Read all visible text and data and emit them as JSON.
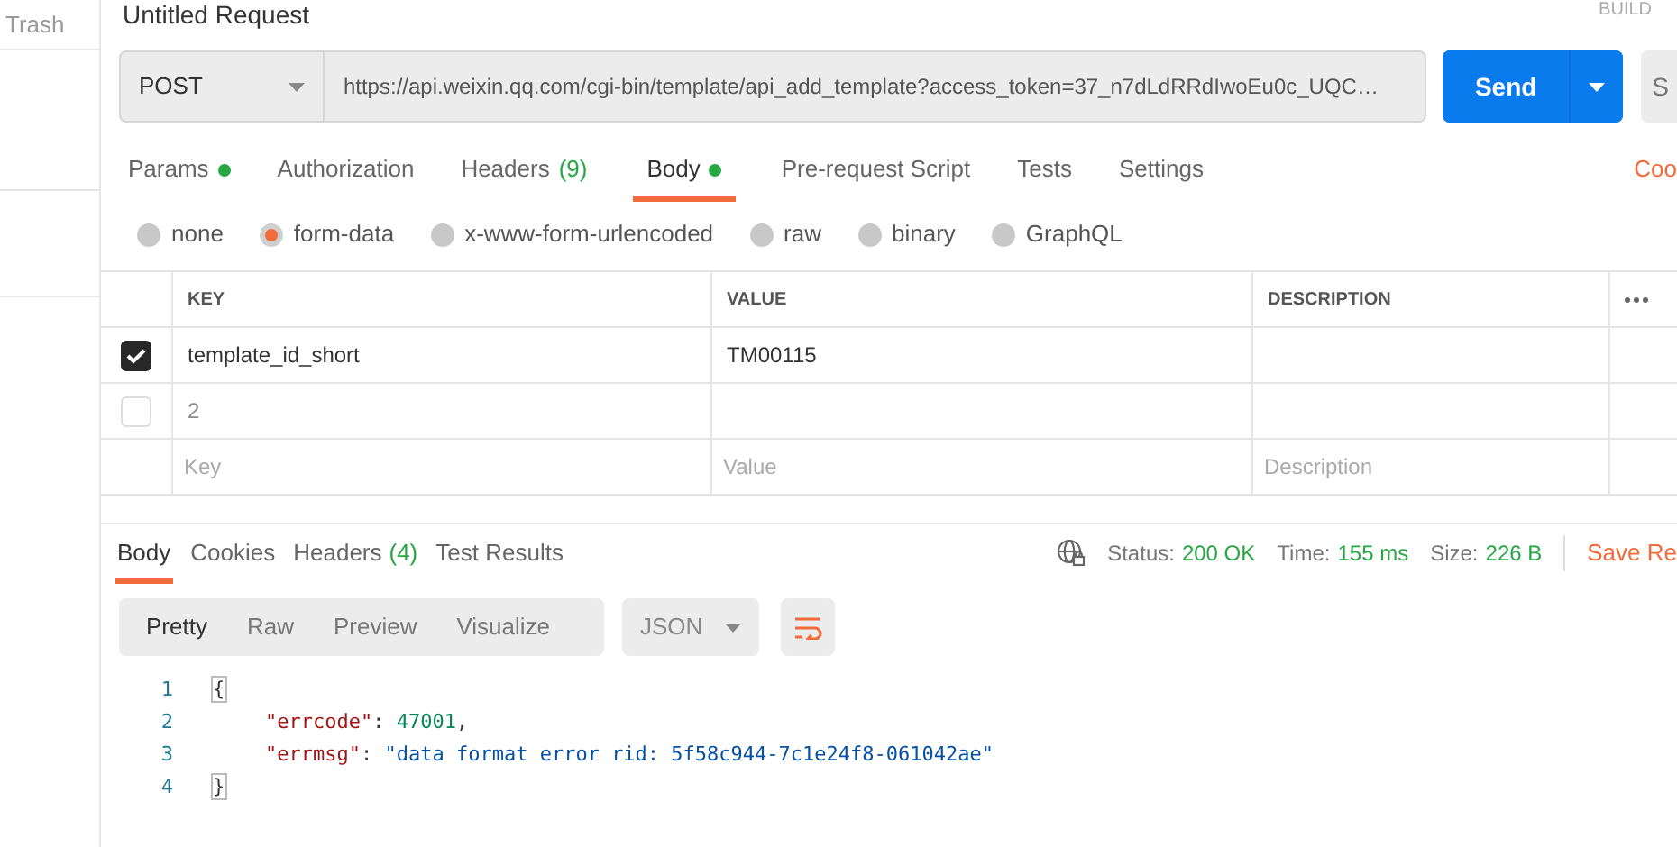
{
  "sidebar": {
    "items": [
      {
        "label": "Trash"
      }
    ]
  },
  "request": {
    "title": "Untitled Request",
    "build_label": "BUILD",
    "method": "POST",
    "url": "https://api.weixin.qq.com/cgi-bin/template/api_add_template?access_token=37_n7dLdRRdIwoEu0c_UQC…",
    "send_label": "Send",
    "save_label": "S"
  },
  "request_tabs": [
    {
      "label": "Params",
      "has_dot": true,
      "selected": false
    },
    {
      "label": "Authorization",
      "has_dot": false,
      "selected": false
    },
    {
      "label": "Headers",
      "count": "(9)",
      "has_dot": false,
      "selected": false
    },
    {
      "label": "Body",
      "has_dot": true,
      "selected": true
    },
    {
      "label": "Pre-request Script",
      "has_dot": false,
      "selected": false
    },
    {
      "label": "Tests",
      "has_dot": false,
      "selected": false
    },
    {
      "label": "Settings",
      "has_dot": false,
      "selected": false
    }
  ],
  "cookies_link": "Coo",
  "body_types": [
    {
      "label": "none",
      "selected": false
    },
    {
      "label": "form-data",
      "selected": true
    },
    {
      "label": "x-www-form-urlencoded",
      "selected": false
    },
    {
      "label": "raw",
      "selected": false
    },
    {
      "label": "binary",
      "selected": false
    },
    {
      "label": "GraphQL",
      "selected": false
    }
  ],
  "params_table": {
    "columns": [
      "KEY",
      "VALUE",
      "DESCRIPTION"
    ],
    "rows": [
      {
        "checked": true,
        "key": "template_id_short",
        "value": "TM00115"
      },
      {
        "checked": false,
        "key": "2"
      }
    ],
    "new_row": {
      "key_placeholder": "Key",
      "value_placeholder": "Value",
      "description_placeholder": "Description"
    }
  },
  "response": {
    "tabs": [
      {
        "label": "Body",
        "selected": true
      },
      {
        "label": "Cookies",
        "selected": false
      },
      {
        "label": "Headers",
        "count": "(4)",
        "selected": false
      },
      {
        "label": "Test Results",
        "selected": false
      }
    ],
    "stats": [
      {
        "label": "Status:",
        "value": "200 OK"
      },
      {
        "label": "Time:",
        "value": "155 ms"
      },
      {
        "label": "Size:",
        "value": "226 B"
      }
    ],
    "save_label": "Save Re",
    "view_modes": [
      {
        "label": "Pretty",
        "selected": true
      },
      {
        "label": "Raw",
        "selected": false
      },
      {
        "label": "Preview",
        "selected": false
      },
      {
        "label": "Visualize",
        "selected": false
      }
    ],
    "format": "JSON",
    "lines": [
      {
        "number": "1",
        "kind": "brace",
        "tokens": [
          {
            "kind": "punct",
            "text": "{"
          }
        ]
      },
      {
        "number": "2",
        "kind": "member",
        "tokens": [
          {
            "kind": "key",
            "text": "\"errcode\""
          },
          {
            "kind": "punct",
            "text": ": "
          },
          {
            "kind": "number",
            "text": "47001"
          },
          {
            "kind": "punct",
            "text": ","
          }
        ]
      },
      {
        "number": "3",
        "kind": "member",
        "tokens": [
          {
            "kind": "key",
            "text": "\"errmsg\""
          },
          {
            "kind": "punct",
            "text": ": "
          },
          {
            "kind": "string",
            "text": "\"data format error rid: 5f58c944-7c1e24f8-061042ae\""
          }
        ]
      },
      {
        "number": "4",
        "kind": "brace",
        "tokens": [
          {
            "kind": "punct",
            "text": "}"
          }
        ]
      }
    ]
  }
}
